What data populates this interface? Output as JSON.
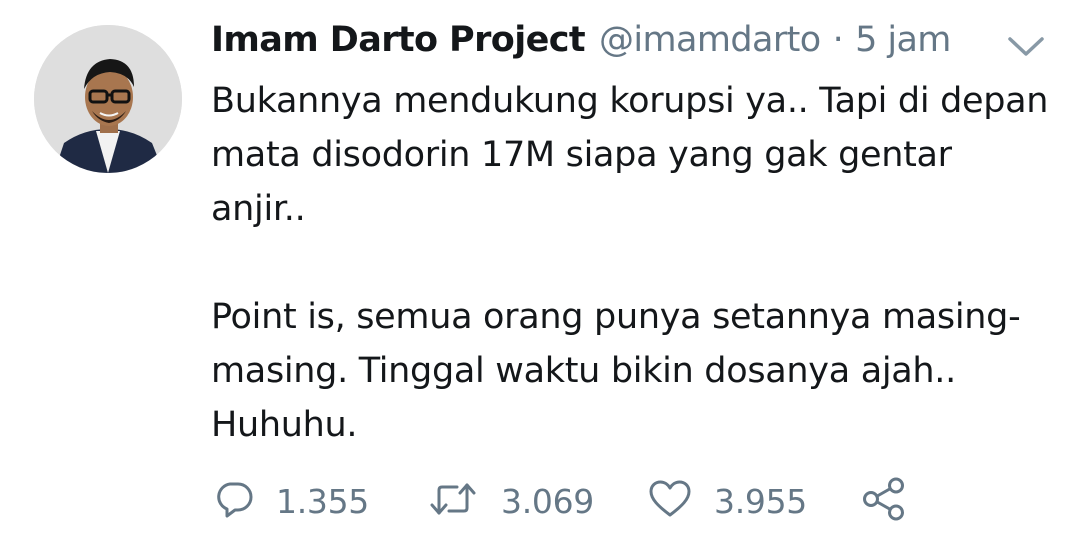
{
  "tweet": {
    "author_name": "Imam Darto Project",
    "handle": "@imamdarto",
    "separator": "·",
    "time": "5 jam",
    "paragraphs": [
      "Bukannya mendukung korupsi ya.. Tapi di depan mata disodorin 17M siapa yang gak gentar anjir..",
      "Point is, semua orang punya setannya masing-masing. Tinggal waktu bikin dosanya ajah.. Huhuhu."
    ],
    "actions": {
      "reply": {
        "icon": "reply-icon",
        "count": "1.355"
      },
      "retweet": {
        "icon": "retweet-icon",
        "count": "3.069"
      },
      "like": {
        "icon": "heart-icon",
        "count": "3.955"
      },
      "share": {
        "icon": "share-icon"
      }
    }
  },
  "colors": {
    "text": "#14171a",
    "secondary": "#657786",
    "background": "#ffffff"
  }
}
